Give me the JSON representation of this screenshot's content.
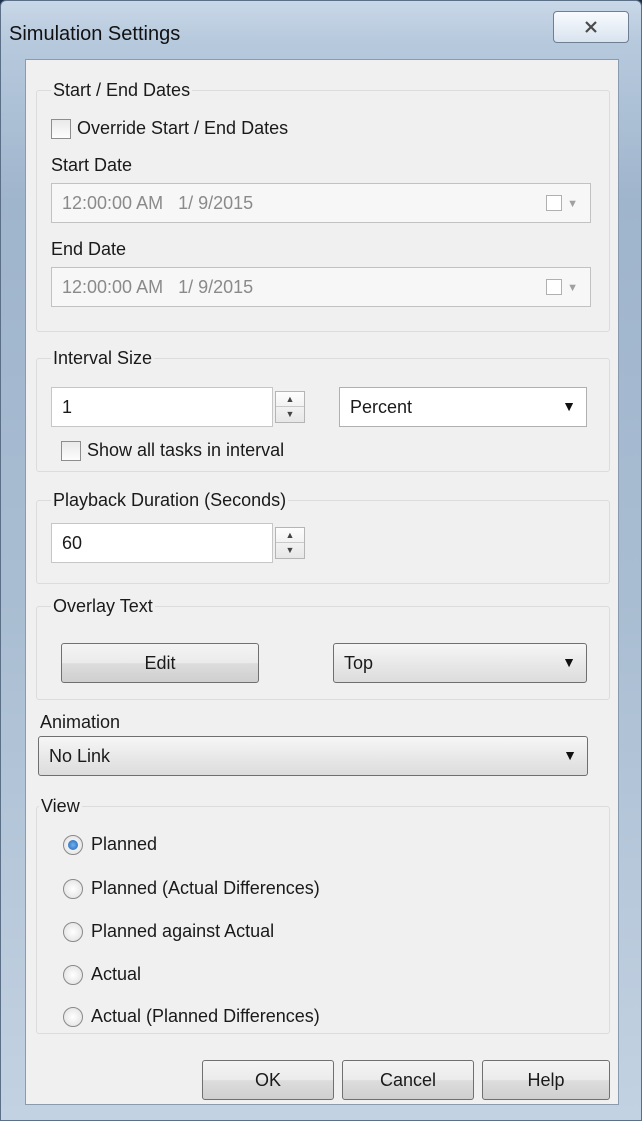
{
  "window": {
    "title": "Simulation Settings",
    "close_icon": "close-icon"
  },
  "dates": {
    "group_label": "Start / End Dates",
    "override_label": "Override Start / End Dates",
    "override_checked": false,
    "start_label": "Start Date",
    "start_value": "12:00:00 AM   1/ 9/2015",
    "end_label": "End Date",
    "end_value": "12:00:00 AM   1/ 9/2015"
  },
  "interval": {
    "group_label": "Interval Size",
    "value": "1",
    "unit": "Percent",
    "show_all_label": "Show all tasks in interval",
    "show_all_checked": false
  },
  "playback": {
    "group_label": "Playback Duration (Seconds)",
    "value": "60"
  },
  "overlay": {
    "group_label": "Overlay Text",
    "edit_label": "Edit",
    "position": "Top"
  },
  "animation": {
    "group_label": "Animation",
    "value": "No Link"
  },
  "view": {
    "group_label": "View",
    "options": [
      "Planned",
      "Planned (Actual Differences)",
      "Planned against Actual",
      "Actual",
      "Actual (Planned Differences)"
    ],
    "selected": "Planned"
  },
  "buttons": {
    "ok": "OK",
    "cancel": "Cancel",
    "help": "Help"
  }
}
